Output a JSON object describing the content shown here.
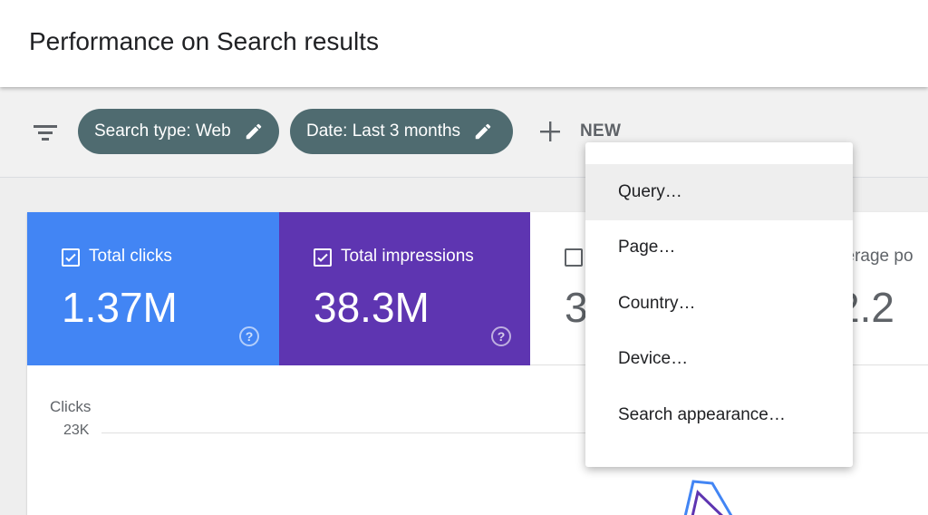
{
  "header": {
    "title": "Performance on Search results"
  },
  "toolbar": {
    "chips": [
      {
        "label": "Search type: Web"
      },
      {
        "label": "Date: Last 3 months"
      }
    ],
    "new_label": "NEW"
  },
  "metrics": [
    {
      "label": "Total clicks",
      "value": "1.37M",
      "checked": true,
      "color": "#4285f4"
    },
    {
      "label": "Total impressions",
      "value": "38.3M",
      "checked": true,
      "color": "#5e35b1"
    },
    {
      "label": "",
      "value": "3",
      "checked": false
    },
    {
      "label": "verage po",
      "value": "2.2",
      "checked": false
    }
  ],
  "chart": {
    "ylabel": "Clicks",
    "top_tick": "23K"
  },
  "menu": {
    "items": [
      {
        "label": "Query…"
      },
      {
        "label": "Page…"
      },
      {
        "label": "Country…"
      },
      {
        "label": "Device…"
      },
      {
        "label": "Search appearance…"
      }
    ],
    "active_index": 0
  },
  "icons": {
    "filter": "filter-list-icon",
    "edit": "pencil-icon",
    "add": "plus-icon",
    "help": "question-circle-icon",
    "check": "checkbox-icon"
  },
  "colors": {
    "chip_bg": "#4f6b70",
    "clicks": "#4285f4",
    "impressions": "#5e35b1"
  }
}
